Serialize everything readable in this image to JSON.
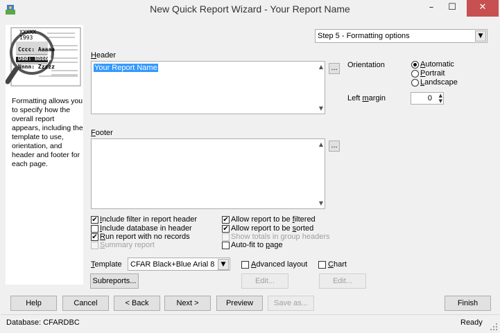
{
  "window": {
    "title": "New Quick Report Wizard - Your Report Name",
    "minimize_glyph": "–",
    "maximize_glyph": "☐",
    "close_glyph": "✕"
  },
  "left_panel": {
    "description": "Formatting allows you to specify how the overall report appears, including the template to use, orientation, and header and footer for each page."
  },
  "step_select": {
    "value": "Step 5 - Formatting options"
  },
  "header": {
    "label_pre": "",
    "label_access": "H",
    "label_post": "eader",
    "value": "Your Report Name",
    "ellipsis": "..."
  },
  "footer": {
    "label_pre": "",
    "label_access": "F",
    "label_post": "ooter",
    "value": "",
    "ellipsis": "..."
  },
  "orientation": {
    "label": "Orientation",
    "options": [
      {
        "pre": "",
        "access": "A",
        "post": "utomatic",
        "selected": true
      },
      {
        "pre": "",
        "access": "P",
        "post": "ortrait",
        "selected": false
      },
      {
        "pre": "",
        "access": "L",
        "post": "andscape",
        "selected": false
      }
    ]
  },
  "left_margin": {
    "label_pre": "Left ",
    "label_access": "m",
    "label_post": "argin",
    "value": "0"
  },
  "checkboxes_left": [
    {
      "pre": "",
      "access": "I",
      "post": "nclude filter in report header",
      "checked": true,
      "disabled": false
    },
    {
      "pre": "",
      "access": "I",
      "post": "nclude database in header",
      "checked": false,
      "disabled": false
    },
    {
      "pre": "",
      "access": "R",
      "post": "un report with no records",
      "checked": true,
      "disabled": true
    },
    {
      "pre": "",
      "access": "S",
      "post": "ummary report",
      "checked": false,
      "disabled": true
    }
  ],
  "checkboxes_right": [
    {
      "pre": "Allow report to be ",
      "access": "f",
      "post": "iltered",
      "checked": true,
      "disabled": false
    },
    {
      "pre": "Allow report to be ",
      "access": "s",
      "post": "orted",
      "checked": true,
      "disabled": false
    },
    {
      "pre": "Show totals in group headers",
      "access": "",
      "post": "",
      "checked": false,
      "disabled": true
    },
    {
      "pre": "Auto-fit to ",
      "access": "p",
      "post": "age",
      "checked": false,
      "disabled": false
    }
  ],
  "template": {
    "label_pre": "",
    "label_access": "T",
    "label_post": "emplate",
    "value": "CFAR Black+Blue Arial 8"
  },
  "advanced_layout": {
    "pre": "",
    "access": "A",
    "post": "dvanced layout",
    "checked": false
  },
  "chart": {
    "pre": "",
    "access": "C",
    "post": "hart",
    "checked": false
  },
  "buttons": {
    "subreports": "Subreports...",
    "edit_advanced": "Edit...",
    "edit_chart": "Edit...",
    "help": "Help",
    "cancel": "Cancel",
    "back": "< Back",
    "next": "Next >",
    "preview": "Preview",
    "save_as": "Save as...",
    "finish": "Finish"
  },
  "status": {
    "database": "Database: CFARDBC",
    "state": "Ready"
  },
  "illustration": {
    "line1": "XXXXX",
    "line2": "1993",
    "line3": "Cccc: Aaaaa",
    "line4": "Ddd: Bbbbb",
    "line5": "Nnnn: Zzzzz"
  },
  "colors": {
    "selection": "#3399ff",
    "close_button": "#c75050"
  }
}
